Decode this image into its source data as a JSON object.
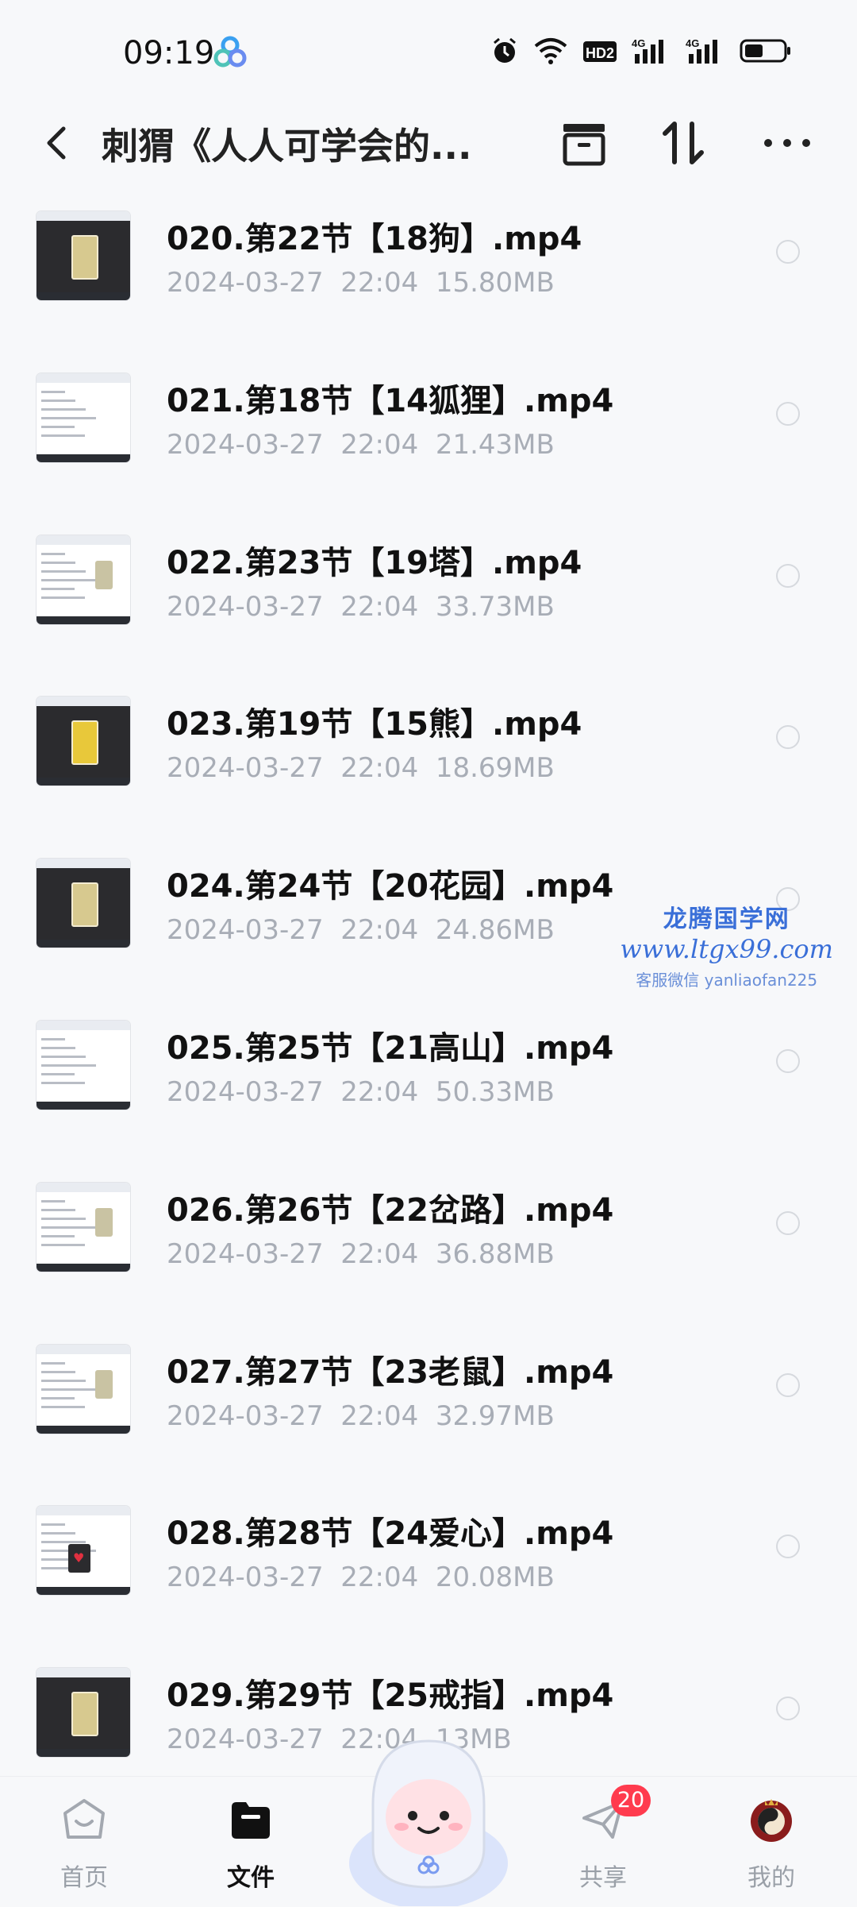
{
  "status_bar": {
    "time": "09:19",
    "icons": [
      "app-icon",
      "alarm-icon",
      "wifi-icon",
      "hd-icon",
      "signal-4g-icon",
      "signal-4g-icon",
      "battery-icon"
    ]
  },
  "nav": {
    "title": "刺猬《人人可学会的...",
    "icons": [
      "back-icon",
      "window-icon",
      "sort-icon",
      "more-icon"
    ]
  },
  "files": [
    {
      "name": "020.第22节【18狗】.mp4",
      "date": "2024-03-27",
      "time": "22:04",
      "size": "15.80MB",
      "thumb": "card-dark"
    },
    {
      "name": "021.第18节【14狐狸】.mp4",
      "date": "2024-03-27",
      "time": "22:04",
      "size": "21.43MB",
      "thumb": "doc"
    },
    {
      "name": "022.第23节【19塔】.mp4",
      "date": "2024-03-27",
      "time": "22:04",
      "size": "33.73MB",
      "thumb": "doc-card"
    },
    {
      "name": "023.第19节【15熊】.mp4",
      "date": "2024-03-27",
      "time": "22:04",
      "size": "18.69MB",
      "thumb": "card-yellow"
    },
    {
      "name": "024.第24节【20花园】.mp4",
      "date": "2024-03-27",
      "time": "22:04",
      "size": "24.86MB",
      "thumb": "card-dark"
    },
    {
      "name": "025.第25节【21高山】.mp4",
      "date": "2024-03-27",
      "time": "22:04",
      "size": "50.33MB",
      "thumb": "doc"
    },
    {
      "name": "026.第26节【22岔路】.mp4",
      "date": "2024-03-27",
      "time": "22:04",
      "size": "36.88MB",
      "thumb": "doc-card"
    },
    {
      "name": "027.第27节【23老鼠】.mp4",
      "date": "2024-03-27",
      "time": "22:04",
      "size": "32.97MB",
      "thumb": "doc-card"
    },
    {
      "name": "028.第28节【24爱心】.mp4",
      "date": "2024-03-27",
      "time": "22:04",
      "size": "20.08MB",
      "thumb": "doc-heart"
    },
    {
      "name": "029.第29节【25戒指】.mp4",
      "date": "2024-03-27",
      "time": "22:04",
      "size": "13MB",
      "thumb": "card-dark"
    }
  ],
  "watermark": {
    "line1": "龙腾国学网",
    "line2": "www.ltgx99.com",
    "line3": "客服微信 yanliaofan225"
  },
  "tabbar": {
    "tabs": [
      {
        "label": "首页",
        "icon": "home-icon"
      },
      {
        "label": "文件",
        "icon": "folder-icon",
        "active": true
      },
      {
        "label": "共享",
        "icon": "share-icon",
        "badge": "20"
      },
      {
        "label": "我的",
        "icon": "avatar-icon"
      }
    ]
  },
  "colors": {
    "accent": "#111111",
    "meta_text": "#a8adb6",
    "badge": "#ff3b4e",
    "watermark": "#3a6fd8"
  }
}
